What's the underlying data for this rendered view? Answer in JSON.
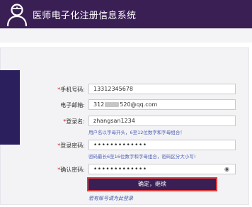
{
  "header": {
    "title": "医师电子化注册信息系统",
    "logo_icon": "doctor-icon",
    "bg_color": "#3a1f55"
  },
  "form": {
    "phone": {
      "label": "手机号码:",
      "required": true,
      "value": "13312345678"
    },
    "email": {
      "label": "电子邮箱:",
      "required": false,
      "value_prefix": "312",
      "value_suffix": "520@qq.com"
    },
    "username": {
      "label": "登录名:",
      "required": true,
      "value": "zhangsan1234",
      "hint": "用户名以字母开头，6至12位数字和字母组合！"
    },
    "password": {
      "label": "登录密码:",
      "required": true,
      "value": "•••••••••••••",
      "hint": "密码最长6至16位数字和字母组合，密码区分大小写!"
    },
    "confirm_password": {
      "label": "确认密码:",
      "required": true,
      "value": "•••••••••••••",
      "eye_icon": "eye-icon"
    },
    "required_mark": "*"
  },
  "actions": {
    "confirm_label": "确定，继续",
    "login_link": "若有账号请为此登录"
  },
  "colors": {
    "accent": "#3a1f55",
    "highlight_border": "#e03b3b",
    "hint": "#4d5fb5"
  }
}
